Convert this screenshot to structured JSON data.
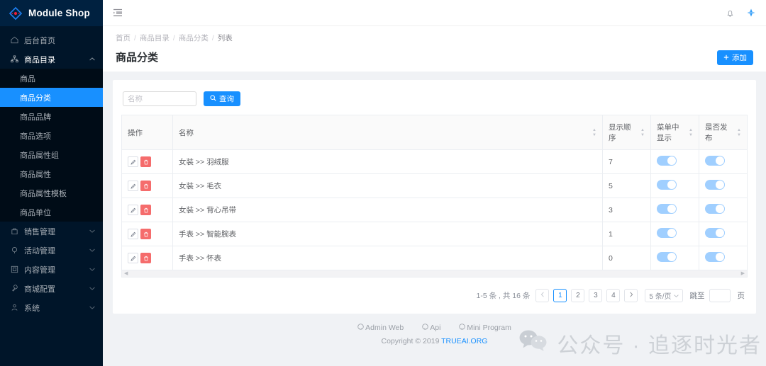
{
  "brand": {
    "name": "Module Shop",
    "accent": "#1890ff",
    "logo_icon": "diamond-logo-icon"
  },
  "sidebar": {
    "items": [
      {
        "label": "后台首页",
        "icon": "home-icon",
        "type": "link"
      },
      {
        "label": "商品目录",
        "icon": "sitemap-icon",
        "type": "group",
        "expanded": true,
        "children": [
          {
            "label": "商品",
            "active": false
          },
          {
            "label": "商品分类",
            "active": true
          },
          {
            "label": "商品品牌",
            "active": false
          },
          {
            "label": "商品选项",
            "active": false
          },
          {
            "label": "商品属性组",
            "active": false
          },
          {
            "label": "商品属性",
            "active": false
          },
          {
            "label": "商品属性模板",
            "active": false
          },
          {
            "label": "商品单位",
            "active": false
          }
        ]
      },
      {
        "label": "销售管理",
        "icon": "bag-icon",
        "type": "group",
        "expanded": false
      },
      {
        "label": "活动管理",
        "icon": "tag-icon",
        "type": "group",
        "expanded": false
      },
      {
        "label": "内容管理",
        "icon": "window-icon",
        "type": "group",
        "expanded": false
      },
      {
        "label": "商城配置",
        "icon": "wrench-icon",
        "type": "group",
        "expanded": false
      },
      {
        "label": "系统",
        "icon": "user-icon",
        "type": "group",
        "expanded": false
      }
    ]
  },
  "topbar": {
    "collapse_icon": "menu-fold-icon",
    "bell_icon": "bell-icon",
    "apps_icon": "apps-dots-icon"
  },
  "page": {
    "breadcrumb": [
      "首页",
      "商品目录",
      "商品分类",
      "列表"
    ],
    "breadcrumb_separator": "/",
    "title": "商品分类",
    "add_label": "添加",
    "add_icon": "plus-icon"
  },
  "search": {
    "placeholder": "名称",
    "value": "",
    "button_label": "查询",
    "button_icon": "search-icon"
  },
  "table": {
    "columns": [
      {
        "label": "操作",
        "sortable": false
      },
      {
        "label": "名称",
        "sortable": true
      },
      {
        "label": "显示顺序",
        "sortable": true
      },
      {
        "label": "菜单中显示",
        "sortable": true
      },
      {
        "label": "是否发布",
        "sortable": true
      }
    ],
    "row_actions": {
      "edit_icon": "pencil-icon",
      "delete_icon": "trash-icon"
    },
    "rows": [
      {
        "name": "女装 >> 羽绒服",
        "order": "7",
        "menu_show": true,
        "published": true
      },
      {
        "name": "女装 >> 毛衣",
        "order": "5",
        "menu_show": true,
        "published": true
      },
      {
        "name": "女装 >> 背心吊带",
        "order": "3",
        "menu_show": true,
        "published": true
      },
      {
        "name": "手表 >> 智能腕表",
        "order": "1",
        "menu_show": true,
        "published": true
      },
      {
        "name": "手表 >> 怀表",
        "order": "0",
        "menu_show": true,
        "published": true
      }
    ]
  },
  "pagination": {
    "total_text": "1-5 条 , 共 16 条",
    "prev_icon": "chevron-left-icon",
    "next_icon": "chevron-right-icon",
    "pages": [
      "1",
      "2",
      "3",
      "4"
    ],
    "current_page": "1",
    "page_size_label": "5 条/页",
    "page_size_icon": "chevron-down-icon",
    "jump_label": "跳至",
    "jump_value": "",
    "jump_suffix": "页"
  },
  "footer": {
    "links": [
      {
        "label": "Admin Web",
        "icon": "github-icon"
      },
      {
        "label": "Api",
        "icon": "github-icon"
      },
      {
        "label": "Mini Program",
        "icon": "github-icon"
      }
    ],
    "copyright_prefix": "Copyright",
    "copyright_symbol": "©",
    "copyright_year": "2019",
    "copyright_brand": "TRUEAI.ORG"
  },
  "watermark": {
    "icon": "wechat-icon",
    "text": "公众号 · 追逐时光者"
  }
}
